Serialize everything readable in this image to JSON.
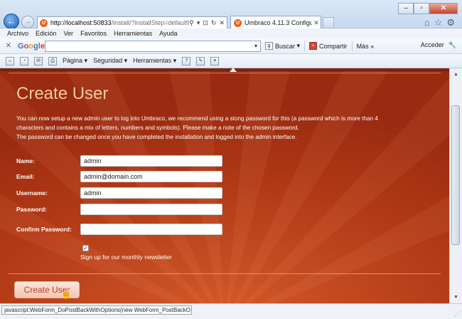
{
  "browser": {
    "address_host": "http://localhost:50833",
    "address_rest": "/install/?installStep=defaultUser",
    "tab_title": "Umbraco 4.11.3 Configurat...",
    "favicon_letter": "U",
    "menu": [
      "Archivo",
      "Edición",
      "Ver",
      "Favoritos",
      "Herramientas",
      "Ayuda"
    ],
    "google_toolbar": {
      "logo": "Google",
      "search_button": "Buscar",
      "share_button": "Compartir",
      "more": "Más »",
      "signin": "Acceder"
    },
    "command_bar": {
      "page": "Página",
      "safety": "Seguridad",
      "tools": "Herramientas"
    },
    "status_text": "javascript:WebForm_DoPostBackWithOptions(new WebForm_PostBackO..."
  },
  "page": {
    "title": "Create User",
    "intro_lines": [
      "You can now setup a new admin user to log into Umbraco, we recommend using a stong password for this (a password which is more than 4",
      "characters and contains a mix of letters, numbers and symbols). Please make a note of the chosen password.",
      "The password can be changed once you have completed the installation and logged into the admin interface."
    ],
    "form": {
      "name_label": "Name:",
      "name_value": "admin",
      "email_label": "Email:",
      "email_value": "admin@domain.com",
      "username_label": "Username:",
      "username_value": "admin",
      "password_label": "Password:",
      "password_value": "",
      "confirm_label": "Confirm Password:",
      "confirm_value": "",
      "newsletter_checked": true,
      "newsletter_label": "Sign up for our monthly newsletter"
    },
    "submit_label": "Create User"
  },
  "colors": {
    "page_background": "#a62f12",
    "title": "#f6c9a2",
    "button_text": "#c0391b"
  },
  "icons": {
    "back": "back-arrow-icon",
    "forward": "forward-arrow-icon",
    "close_tab": "close-icon",
    "home": "home-icon",
    "favorites": "star-icon",
    "settings": "gear-icon"
  }
}
